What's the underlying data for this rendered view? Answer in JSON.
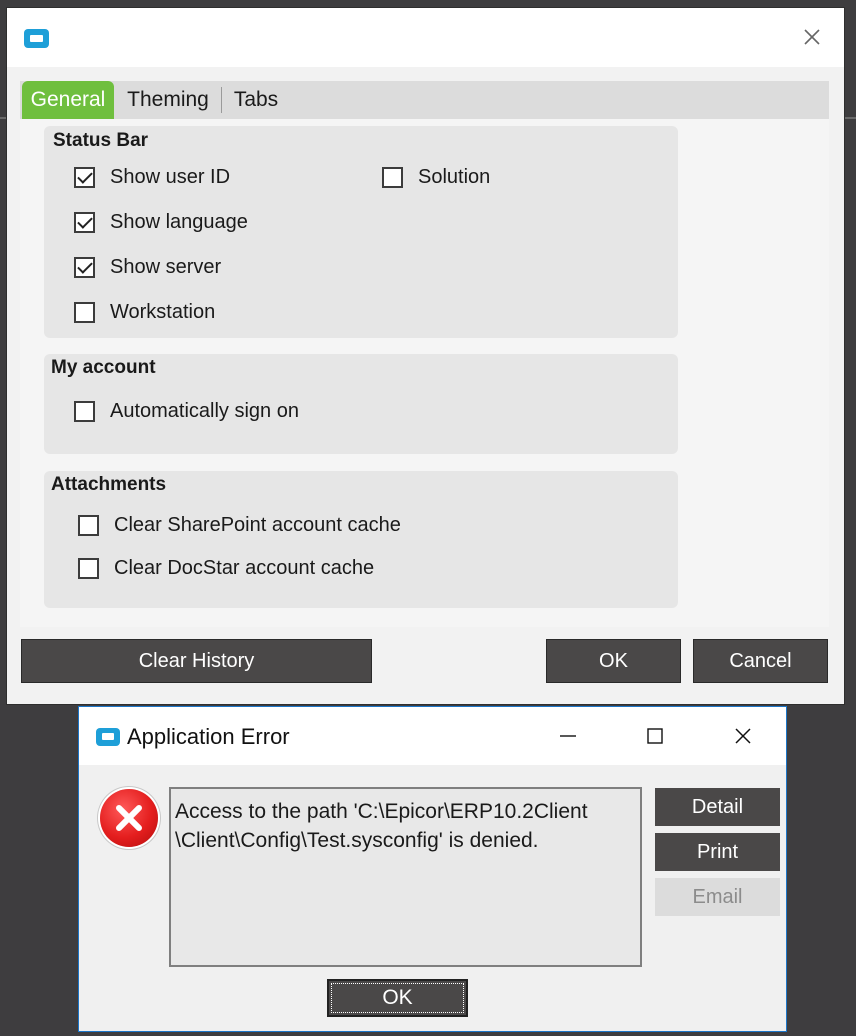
{
  "options_dialog": {
    "tabs": [
      {
        "label": "General"
      },
      {
        "label": "Theming"
      },
      {
        "label": "Tabs"
      }
    ],
    "active_tab": "General",
    "status_bar": {
      "title": "Status Bar",
      "options": [
        {
          "label": "Show user ID",
          "checked": true
        },
        {
          "label": "Show language",
          "checked": true
        },
        {
          "label": "Show server",
          "checked": true
        },
        {
          "label": "Workstation",
          "checked": false
        },
        {
          "label": "Solution",
          "checked": false
        }
      ]
    },
    "my_account": {
      "title": "My account",
      "options": [
        {
          "label": "Automatically sign on",
          "checked": false
        }
      ]
    },
    "attachments": {
      "title": "Attachments",
      "options": [
        {
          "label": "Clear SharePoint account cache",
          "checked": false
        },
        {
          "label": "Clear DocStar account cache",
          "checked": false
        }
      ]
    },
    "buttons": {
      "clear_history": "Clear History",
      "ok": "OK",
      "cancel": "Cancel"
    }
  },
  "error_dialog": {
    "title": "Application Error",
    "message_lines": [
      "Access to the path 'C:\\Epicor\\ERP10.2Client",
      "\\Client\\Config\\Test.sysconfig' is denied."
    ],
    "buttons": {
      "detail": "Detail",
      "print": "Print",
      "email": "Email",
      "ok": "OK"
    }
  },
  "colors": {
    "active_tab": "#6fbf3e",
    "button_dark": "#4a4848",
    "app_icon": "#1e9fd8",
    "error_icon": "#e41e1e",
    "error_border": "#1c76c9"
  }
}
